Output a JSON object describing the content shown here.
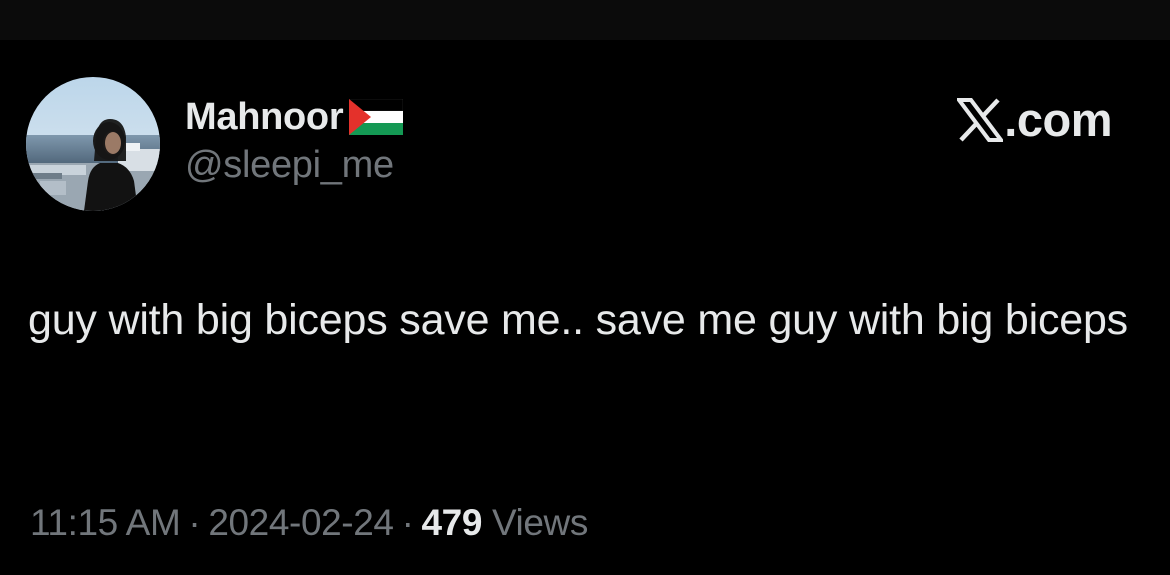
{
  "tweet": {
    "author": {
      "display_name": "Mahnoor",
      "name_emoji": "palestine-flag-icon",
      "handle": "@sleepi_me"
    },
    "brand": {
      "logo_icon": "x-logo-icon",
      "text": ".com"
    },
    "text": "guy with big biceps save me.. save me guy with big biceps",
    "time": "11:15 AM",
    "separator": "·",
    "date": "2024-02-24",
    "views_count": "479",
    "views_label": "Views"
  },
  "colors": {
    "background": "#000000",
    "top_strip": "#0b0b0b",
    "primary_text": "#e7e9ea",
    "secondary_text": "#71767b",
    "flag_red": "#e4312b",
    "flag_green": "#149954",
    "flag_black": "#000000",
    "flag_white": "#ffffff"
  }
}
